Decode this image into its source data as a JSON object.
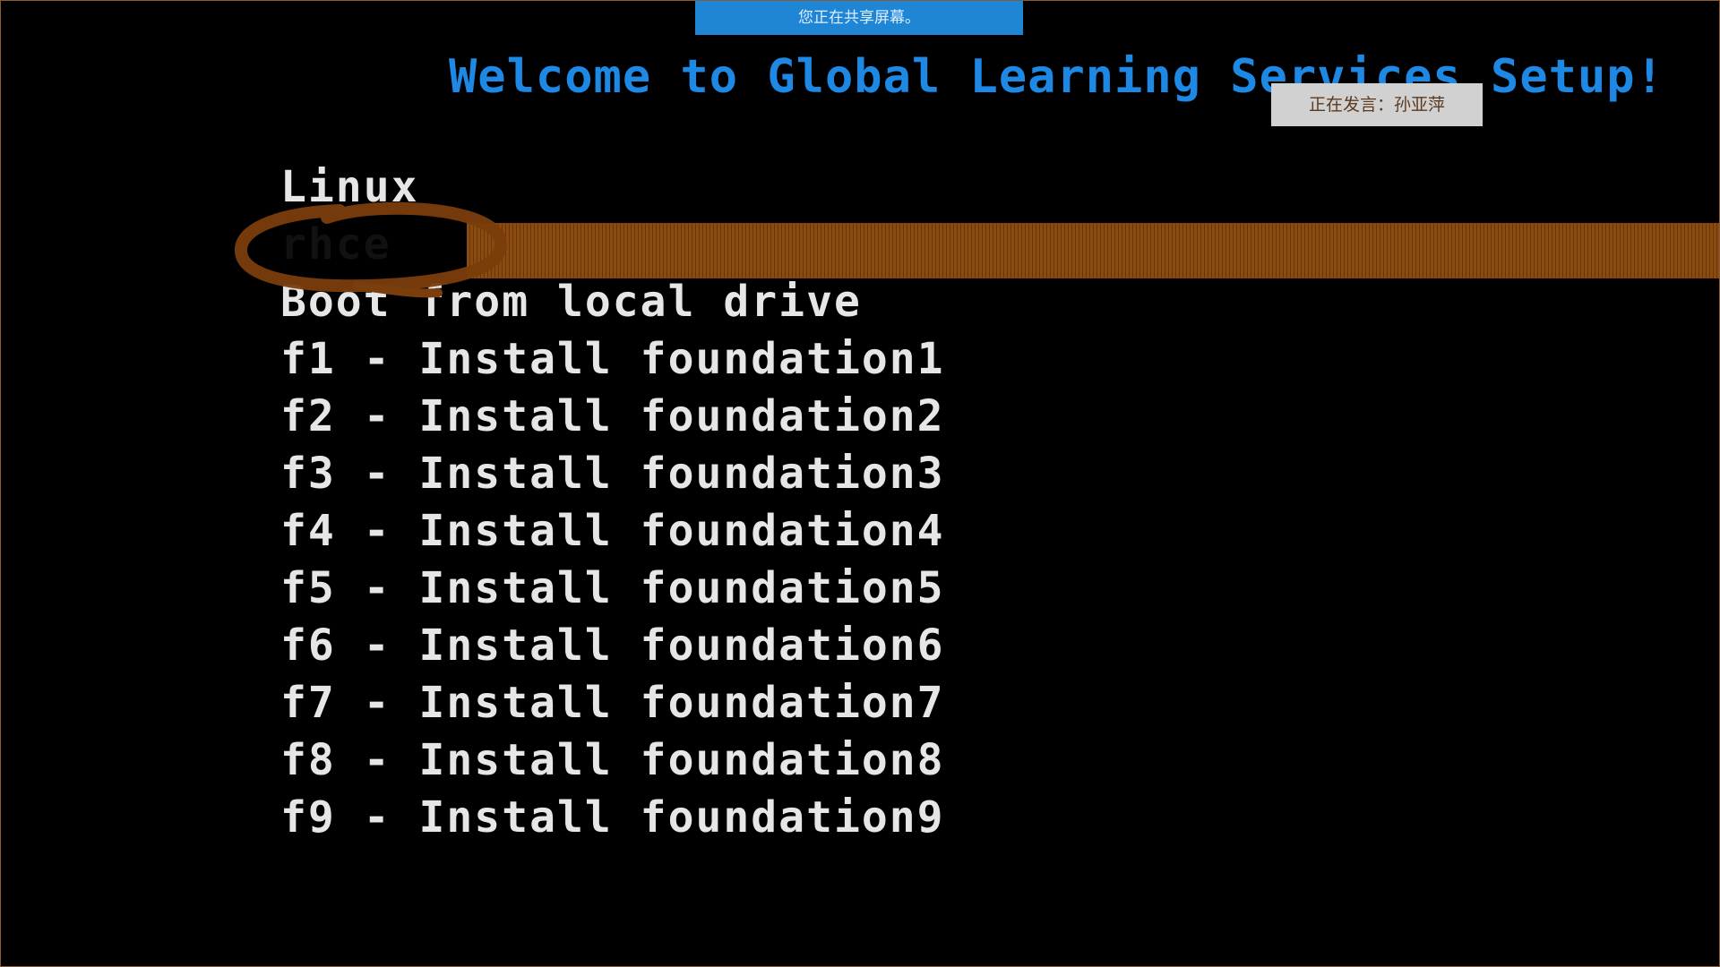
{
  "banner": {
    "sharing_text": "您正在共享屏幕。"
  },
  "speaker": {
    "label": "正在发言：",
    "name": "孙亚萍"
  },
  "title": "Welcome to Global Learning Services Setup!",
  "menu": {
    "selected_index": 1,
    "items": [
      {
        "label": "Linux"
      },
      {
        "label": "rhce"
      },
      {
        "label": "Boot from local drive"
      },
      {
        "label": "f1 - Install foundation1"
      },
      {
        "label": "f2 - Install foundation2"
      },
      {
        "label": "f3 - Install foundation3"
      },
      {
        "label": "f4 - Install foundation4"
      },
      {
        "label": "f5 - Install foundation5"
      },
      {
        "label": "f6 - Install foundation6"
      },
      {
        "label": "f7 - Install foundation7"
      },
      {
        "label": "f8 - Install foundation8"
      },
      {
        "label": "f9 - Install foundation9"
      }
    ]
  },
  "colors": {
    "title": "#1e88e5",
    "menu_text": "#e6e6e6",
    "highlight": "#8b4a0f",
    "annotation_ink": "#7a3d0c",
    "banner": "#1f86d6"
  }
}
